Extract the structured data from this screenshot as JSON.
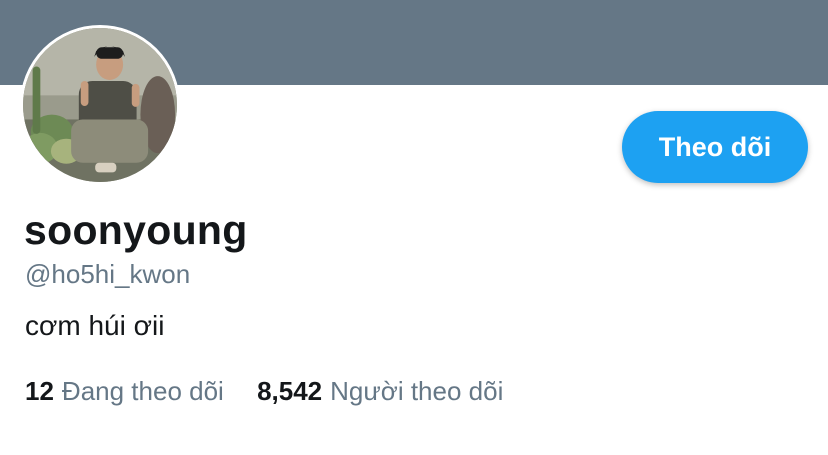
{
  "colors": {
    "banner": "#657786",
    "accent": "#1da1f2",
    "primary_text": "#14171a",
    "secondary_text": "#657786"
  },
  "profile": {
    "display_name": "soonyoung",
    "username": "@ho5hi_kwon",
    "bio": "cơm húi ơii",
    "avatar_icon": "profile-photo"
  },
  "actions": {
    "follow_label": "Theo dõi"
  },
  "stats": {
    "following_count": "12",
    "following_label": "Đang theo dõi",
    "followers_count": "8,542",
    "followers_label": "Người theo dõi"
  }
}
